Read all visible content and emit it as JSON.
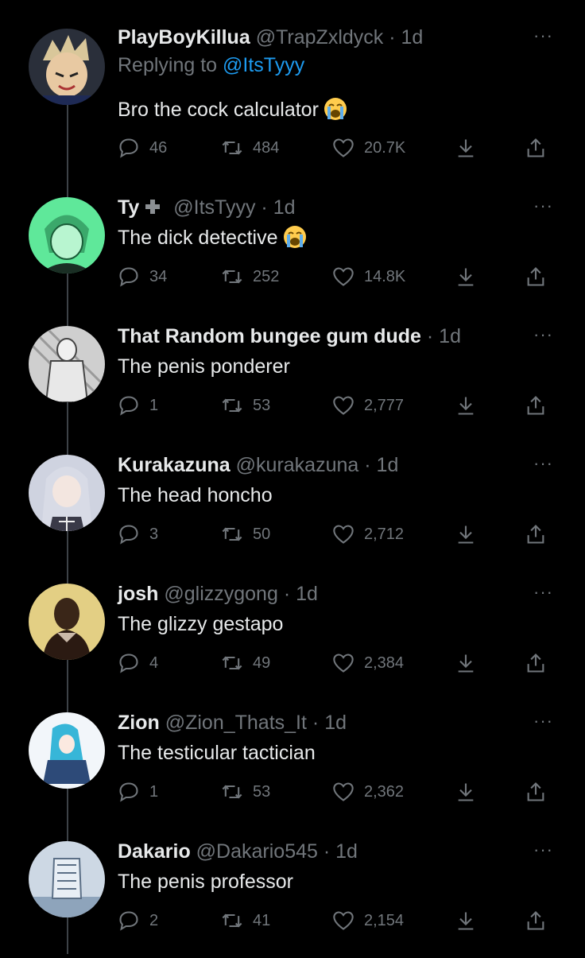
{
  "tweets": [
    {
      "name": "PlayBoyKillua",
      "handle": "@TrapZxldyck",
      "time": "1d",
      "replying_prefix": "Replying to ",
      "replying_to": "@ItsTyyy",
      "text": "Bro the cock calculator",
      "emoji": "loudly-crying-face",
      "replies": "46",
      "retweets": "484",
      "likes": "20.7K",
      "avatar_color": "#c9b38a"
    },
    {
      "name": "Ty",
      "handle": "@ItsTyyy",
      "time": "1d",
      "text": "The dick detective",
      "emoji": "loudly-crying-face",
      "replies": "34",
      "retweets": "252",
      "likes": "14.8K",
      "avatar_color": "#5fe89a"
    },
    {
      "name": "That Random bungee gum dude",
      "handle": "",
      "time": "1d",
      "text": "The penis ponderer",
      "replies": "1",
      "retweets": "53",
      "likes": "2,777",
      "avatar_color": "#8c8c8c"
    },
    {
      "name": "Kurakazuna",
      "handle": "@kurakazuna",
      "time": "1d",
      "text": "The head honcho",
      "replies": "3",
      "retweets": "50",
      "likes": "2,712",
      "avatar_color": "#9aa0b8"
    },
    {
      "name": "josh",
      "handle": "@glizzygong",
      "time": "1d",
      "text": "The glizzy gestapo",
      "replies": "4",
      "retweets": "49",
      "likes": "2,384",
      "avatar_color": "#d8c27a"
    },
    {
      "name": "Zion",
      "handle": "@Zion_Thats_It",
      "time": "1d",
      "text": "The testicular tactician",
      "replies": "1",
      "retweets": "53",
      "likes": "2,362",
      "avatar_color": "#e8eef4"
    },
    {
      "name": "Dakario",
      "handle": "@Dakario545",
      "time": "1d",
      "text": "The penis professor",
      "replies": "2",
      "retweets": "41",
      "likes": "2,154",
      "avatar_color": "#b8c8d8"
    }
  ],
  "separator": "·",
  "more_label": "···",
  "colors": {
    "background": "#000000",
    "text": "#e7e9ea",
    "muted": "#71767b",
    "link": "#1d9bf0",
    "thread_line": "#3d4247"
  }
}
